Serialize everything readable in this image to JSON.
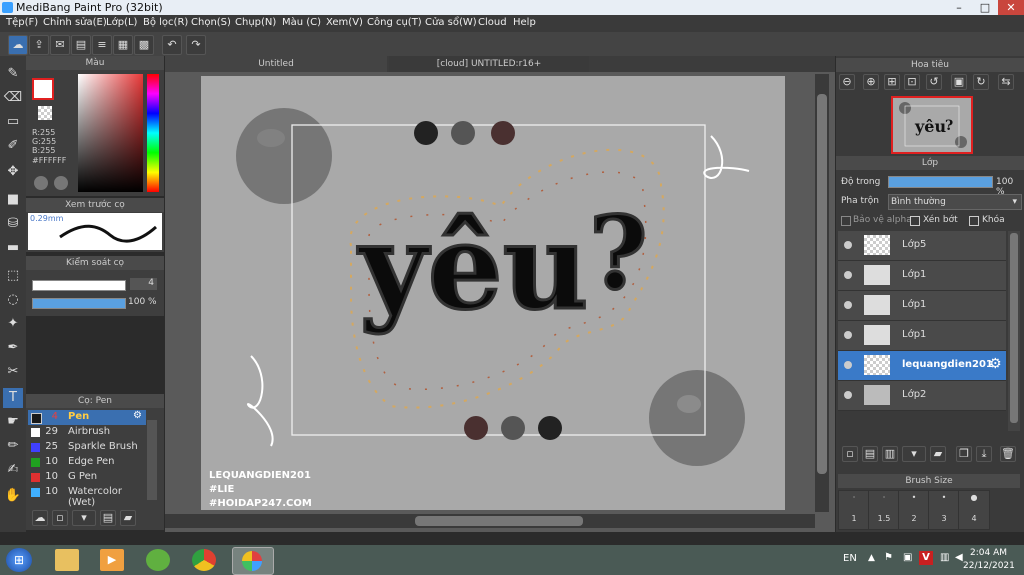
{
  "window": {
    "title": "MediBang Paint Pro (32bit)"
  },
  "menu": [
    "Tệp(F)",
    "Chỉnh sửa(E)",
    "Lớp(L)",
    "Bộ lọc(R)",
    "Chọn(S)",
    "Chụp(N)",
    "Màu (C)",
    "Xem(V)",
    "Công cụ(T)",
    "Cửa sổ(W)",
    "Cloud",
    "Help"
  ],
  "color_panel": {
    "title": "Màu",
    "r": "R:255",
    "g": "G:255",
    "b": "B:255",
    "hex": "#FFFFFF"
  },
  "brush_preview": {
    "title": "Xem trước cọ",
    "size": "0.29mm"
  },
  "brush_control": {
    "title": "Kiểm soát cọ",
    "size_value": "4",
    "opacity_value": "100 %"
  },
  "brush_list": {
    "title": "Cọ: Pen",
    "items": [
      {
        "num": "4",
        "name": "Pen",
        "color": "#1a1a1a"
      },
      {
        "num": "29",
        "name": "Airbrush",
        "color": "#ffffff"
      },
      {
        "num": "25",
        "name": "Sparkle Brush",
        "color": "#4040ff"
      },
      {
        "num": "10",
        "name": "Edge Pen",
        "color": "#20a020"
      },
      {
        "num": "10",
        "name": "G Pen",
        "color": "#e03030"
      },
      {
        "num": "10",
        "name": "Watercolor (Wet)",
        "color": "#40b0ff"
      }
    ]
  },
  "tabs": {
    "tab1": "Untitled",
    "tab2": "[cloud] UNTITLED:r16+"
  },
  "canvas": {
    "word": "yêu",
    "mark": "?",
    "watermark": [
      "LEQUANGDIEN201",
      "#LIE",
      "#HOIDAP247.COM"
    ]
  },
  "navigator": {
    "title": "Hoa tiêu"
  },
  "layers": {
    "title": "Lớp",
    "opacity_label": "Độ trong",
    "opacity_value": "100 %",
    "blend_label": "Pha trộn",
    "blend_value": "Bình thường",
    "protect_alpha": "Bảo vệ alpha",
    "clipping": "Xén bớt",
    "lock": "Khóa",
    "items": [
      "Lớp5",
      "Lớp1",
      "Lớp1",
      "Lớp1",
      "lequangdien201",
      "Lớp2"
    ]
  },
  "brush_size": {
    "title": "Brush Size",
    "labels": [
      "1",
      "1.5",
      "2",
      "3",
      "4"
    ]
  },
  "taskbar": {
    "lang": "EN",
    "time": "2:04 AM",
    "date": "22/12/2021"
  }
}
